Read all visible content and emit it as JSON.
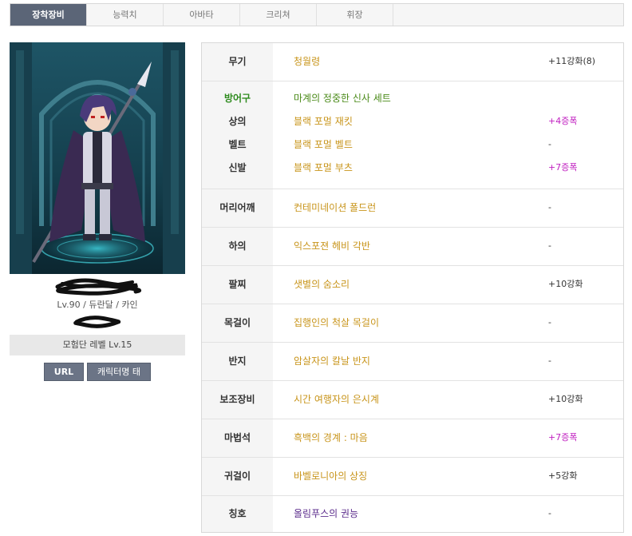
{
  "tabs": [
    {
      "label": "장착장비",
      "active": true
    },
    {
      "label": "능력치",
      "active": false
    },
    {
      "label": "아바타",
      "active": false
    },
    {
      "label": "크리쳐",
      "active": false
    },
    {
      "label": "휘장",
      "active": false
    }
  ],
  "character": {
    "info": "Lv.90 / 듀란달 / 카인",
    "adventure_level": "모험단 레벨 Lv.15",
    "url_button": "URL",
    "tag_button": "캐릭터명 태그"
  },
  "equipment": {
    "weapon": {
      "slot": "무기",
      "item": "청월령",
      "enhance": "+11강화(8)"
    },
    "armor": {
      "header_slot": "방어구",
      "set_name": "마계의 정중한 신사 세트",
      "top": {
        "slot": "상의",
        "item": "블랙 포멀 재킷",
        "enhance": "+4증폭"
      },
      "belt": {
        "slot": "벨트",
        "item": "블랙 포멀 벨트",
        "enhance": "-"
      },
      "shoes": {
        "slot": "신발",
        "item": "블랙 포멀 부츠",
        "enhance": "+7증폭"
      }
    },
    "shoulder": {
      "slot": "머리어깨",
      "item": "컨테미네이션 폴드런",
      "enhance": "-"
    },
    "bottom": {
      "slot": "하의",
      "item": "익스포젼 헤비 각반",
      "enhance": "-"
    },
    "bracelet": {
      "slot": "팔찌",
      "item": "샛별의 숨소리",
      "enhance": "+10강화"
    },
    "necklace": {
      "slot": "목걸이",
      "item": "집행인의 척살 목걸이",
      "enhance": "-"
    },
    "ring": {
      "slot": "반지",
      "item": "암살자의 칼날 반지",
      "enhance": "-"
    },
    "support": {
      "slot": "보조장비",
      "item": "시간 여행자의 은시계",
      "enhance": "+10강화"
    },
    "magic_stone": {
      "slot": "마법석",
      "item": "흑백의 경계 : 마음",
      "enhance": "+7증폭"
    },
    "earring": {
      "slot": "귀걸이",
      "item": "바벨로니아의 상징",
      "enhance": "+5강화"
    },
    "title": {
      "slot": "칭호",
      "item": "올림푸스의 권능",
      "enhance": "-"
    }
  },
  "colors": {
    "tab_active": "#5b6577",
    "item_gold": "#c8941a",
    "set_green": "#4a8a18",
    "title_purple": "#5b2c8c",
    "amplify_magenta": "#c020c0"
  }
}
